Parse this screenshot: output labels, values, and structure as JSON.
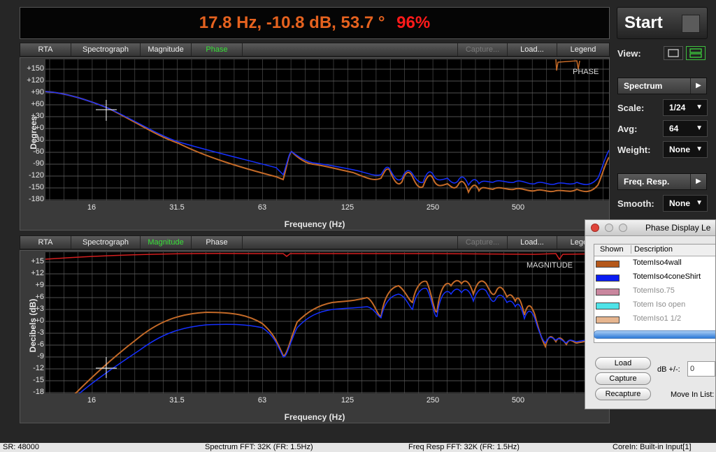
{
  "readout": {
    "values": "17.8 Hz, -10.8 dB, 53.7 °",
    "percent": "96%"
  },
  "tabs_top": [
    {
      "label": "RTA",
      "state": "normal"
    },
    {
      "label": "Spectrograph",
      "state": "normal"
    },
    {
      "label": "Magnitude",
      "state": "normal"
    },
    {
      "label": "Phase",
      "state": "active"
    },
    {
      "label": "Capture...",
      "state": "disabled"
    },
    {
      "label": "Load...",
      "state": "normal"
    },
    {
      "label": "Legend",
      "state": "normal"
    }
  ],
  "tabs_bottom": [
    {
      "label": "RTA",
      "state": "normal"
    },
    {
      "label": "Spectrograph",
      "state": "normal"
    },
    {
      "label": "Magnitude",
      "state": "active"
    },
    {
      "label": "Phase",
      "state": "normal"
    },
    {
      "label": "Capture...",
      "state": "disabled"
    },
    {
      "label": "Load...",
      "state": "normal"
    },
    {
      "label": "Legend",
      "state": "normal"
    }
  ],
  "phase_plot": {
    "tag": "PHASE",
    "ylabel": "Degrees",
    "xlabel": "Frequency (Hz)",
    "yticks": [
      "+150",
      "+120",
      "+90",
      "+60",
      "+30",
      "+0",
      "-30",
      "-60",
      "-90",
      "-120",
      "-150",
      "-180"
    ],
    "xticks": [
      "16",
      "31.5",
      "63",
      "125",
      "250",
      "500"
    ]
  },
  "magnitude_plot": {
    "tag": "MAGNITUDE",
    "ylabel": "Decibels (dB)",
    "xlabel": "Frequency (Hz)",
    "yticks": [
      "+15",
      "+12",
      "+9",
      "+6",
      "+3",
      "+0",
      "-3",
      "-6",
      "-9",
      "-12",
      "-15",
      "-18"
    ],
    "xticks": [
      "16",
      "31.5",
      "63",
      "125",
      "250",
      "500"
    ]
  },
  "controls": {
    "start_label": "Start",
    "view_label": "View:",
    "spectrum_label": "Spectrum",
    "scale_label": "Scale:",
    "scale_value": "1/24",
    "avg_label": "Avg:",
    "avg_value": "64",
    "weight_label": "Weight:",
    "weight_value": "None",
    "freqresp_label": "Freq. Resp.",
    "smooth_label": "Smooth:",
    "smooth_value": "None"
  },
  "legend_window": {
    "title": "Phase Display Le",
    "col_shown": "Shown",
    "col_description": "Description",
    "items": [
      {
        "name": "TotemIso4wall",
        "color": "#b4571a",
        "dim": false
      },
      {
        "name": "TotemIso4coneShirt",
        "color": "#0a1cf2",
        "dim": false
      },
      {
        "name": "TotemIso.75",
        "color": "#c9869e",
        "dim": true
      },
      {
        "name": "Totem Iso open",
        "color": "#4fe3e8",
        "dim": true
      },
      {
        "name": "TotemIso1 1/2",
        "color": "#e6b58f",
        "dim": true
      }
    ],
    "load_label": "Load",
    "capture_label": "Capture",
    "recapture_label": "Recapture",
    "db_label": "dB +/-:",
    "db_value": "0",
    "move_label": "Move In List:"
  },
  "status": {
    "sr": "SR: 48000",
    "spectrum_fft": "Spectrum FFT: 32K (FR: 1.5Hz)",
    "freq_resp_fft": "Freq Resp FFT: 32K (FR: 1.5Hz)",
    "input": "CoreIn: Built-in Input[1]"
  },
  "colors": {
    "trace_orange": "#c46a28",
    "trace_blue": "#1530ff",
    "trace_red": "#d42020",
    "active_tab": "#38e038"
  }
}
